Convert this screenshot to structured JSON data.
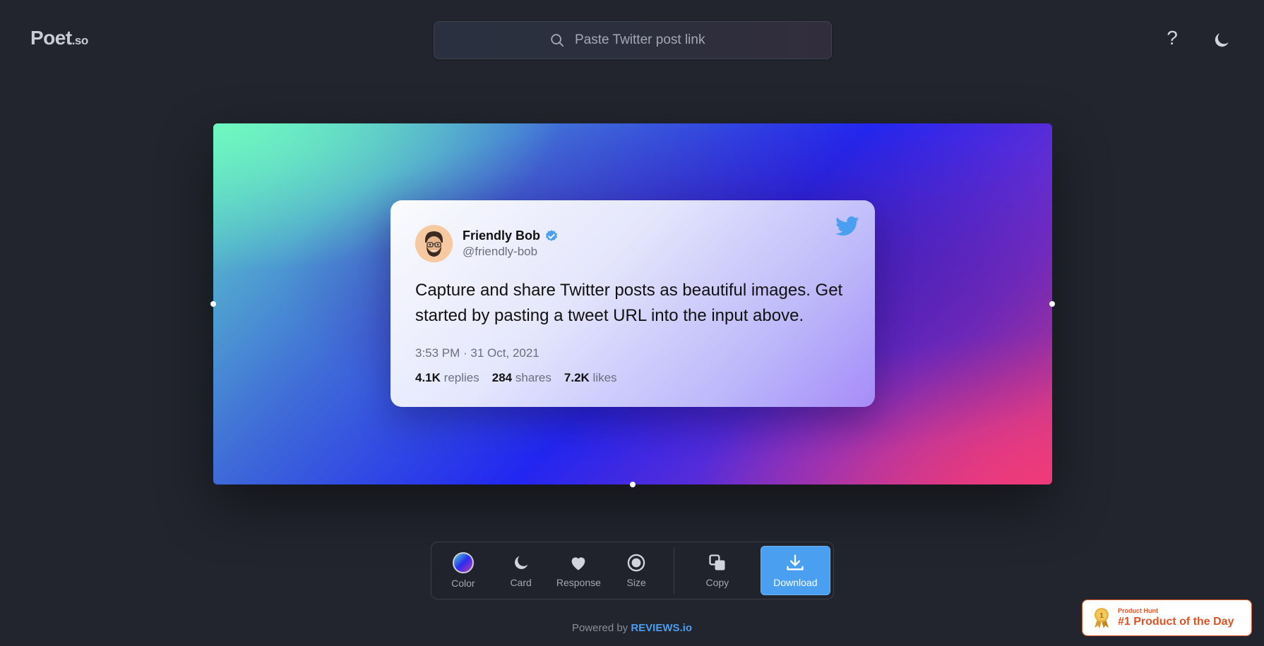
{
  "header": {
    "logo_main": "Poet",
    "logo_tld": ".so",
    "search_placeholder": "Paste Twitter post link",
    "help_label": "?"
  },
  "tweet": {
    "name": "Friendly Bob",
    "handle": "@friendly-bob",
    "text": "Capture and share Twitter posts as beautiful images. Get started by pasting a tweet URL into the input above.",
    "timestamp": "3:53 PM · 31 Oct, 2021",
    "replies_count": "4.1K",
    "replies_label": "replies",
    "shares_count": "284",
    "shares_label": "shares",
    "likes_count": "7.2K",
    "likes_label": "likes"
  },
  "toolbar": {
    "color_label": "Color",
    "card_label": "Card",
    "response_label": "Response",
    "size_label": "Size",
    "copy_label": "Copy",
    "download_label": "Download"
  },
  "footer": {
    "powered_prefix": "Powered by",
    "powered_brand": "REVIEWS.io"
  },
  "badge": {
    "small": "Product Hunt",
    "big": "#1 Product of the Day",
    "medal_number": "1"
  },
  "colors": {
    "background": "#22252e",
    "accent": "#4a9ff0",
    "producthunt": "#dc5425"
  }
}
